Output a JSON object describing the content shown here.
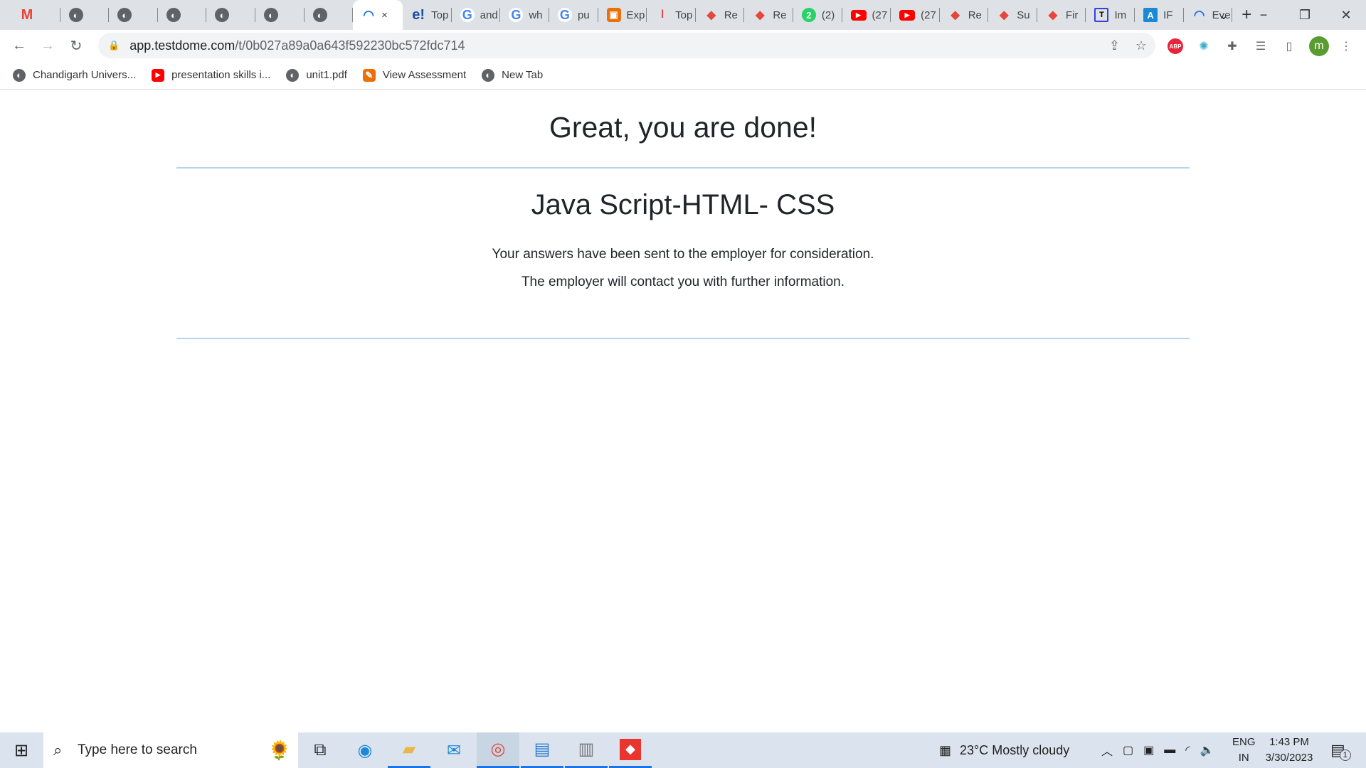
{
  "tabs": [
    {
      "icon": "gmail",
      "glyph": "M",
      "cls": "gm",
      "label": ""
    },
    {
      "icon": "globe",
      "glyph": "◐",
      "cls": "globe",
      "label": ""
    },
    {
      "icon": "globe",
      "glyph": "◐",
      "cls": "globe",
      "label": ""
    },
    {
      "icon": "globe",
      "glyph": "◐",
      "cls": "globe",
      "label": ""
    },
    {
      "icon": "globe",
      "glyph": "◐",
      "cls": "globe",
      "label": ""
    },
    {
      "icon": "globe",
      "glyph": "◐",
      "cls": "globe",
      "label": ""
    },
    {
      "icon": "globe",
      "glyph": "◐",
      "cls": "globe",
      "label": ""
    },
    {
      "icon": "testdome",
      "glyph": "◠",
      "cls": "arc",
      "label": "×",
      "active": true
    },
    {
      "icon": "ebay",
      "glyph": "e!",
      "cls": "eb",
      "label": "Top"
    },
    {
      "icon": "google",
      "glyph": "G",
      "cls": "g",
      "label": "and"
    },
    {
      "icon": "google",
      "glyph": "G",
      "cls": "g",
      "label": "wh"
    },
    {
      "icon": "google",
      "glyph": "G",
      "cls": "g",
      "label": "pu"
    },
    {
      "icon": "orange",
      "glyph": "▣",
      "cls": "or",
      "label": "Exp"
    },
    {
      "icon": "bars",
      "glyph": "ǀ",
      "cls": "red",
      "label": "Top"
    },
    {
      "icon": "diamond",
      "glyph": "◆",
      "cls": "red",
      "label": "Re"
    },
    {
      "icon": "diamond",
      "glyph": "◆",
      "cls": "red",
      "label": "Re"
    },
    {
      "icon": "whatsapp",
      "glyph": "2",
      "cls": "wa",
      "label": "(2)"
    },
    {
      "icon": "youtube",
      "glyph": "▶",
      "cls": "yt",
      "label": "(27"
    },
    {
      "icon": "youtube",
      "glyph": "▶",
      "cls": "yt",
      "label": "(27"
    },
    {
      "icon": "diamond",
      "glyph": "◆",
      "cls": "red",
      "label": "Re"
    },
    {
      "icon": "diamond",
      "glyph": "◆",
      "cls": "red",
      "label": "Su"
    },
    {
      "icon": "diamond",
      "glyph": "◆",
      "cls": "red",
      "label": "Fir"
    },
    {
      "icon": "boxed-t",
      "glyph": "T",
      "cls": "box",
      "label": "Im"
    },
    {
      "icon": "letter-a",
      "glyph": "A",
      "cls": "blue",
      "label": "IF"
    },
    {
      "icon": "testdome",
      "glyph": "◠",
      "cls": "arc",
      "label": "Eve"
    }
  ],
  "url": {
    "host": "app.testdome.com",
    "path": "/t/0b027a89a0a643f592230bc572fdc714"
  },
  "bookmarks": [
    {
      "label": "Chandigarh Univers...",
      "cls": "globe",
      "glyph": "◐"
    },
    {
      "label": "presentation skills i...",
      "cls": "yt",
      "glyph": "▶"
    },
    {
      "label": "unit1.pdf",
      "cls": "globe",
      "glyph": "◐"
    },
    {
      "label": "View Assessment",
      "cls": "or",
      "glyph": "✎"
    },
    {
      "label": "New Tab",
      "cls": "globe",
      "glyph": "◐"
    }
  ],
  "profile_initial": "m",
  "abp": "ABP",
  "main": {
    "title": "Great, you are done!",
    "subtitle": "Java Script-HTML- CSS",
    "line1": "Your answers have been sent to the employer for consideration.",
    "line2": "The employer will contact you with further information."
  },
  "taskbar": {
    "search_placeholder": "Type here to search",
    "weather": "23°C  Mostly cloudy",
    "lang1": "ENG",
    "lang2": "IN",
    "time": "1:43 PM",
    "date": "3/30/2023",
    "notifications": "1"
  }
}
